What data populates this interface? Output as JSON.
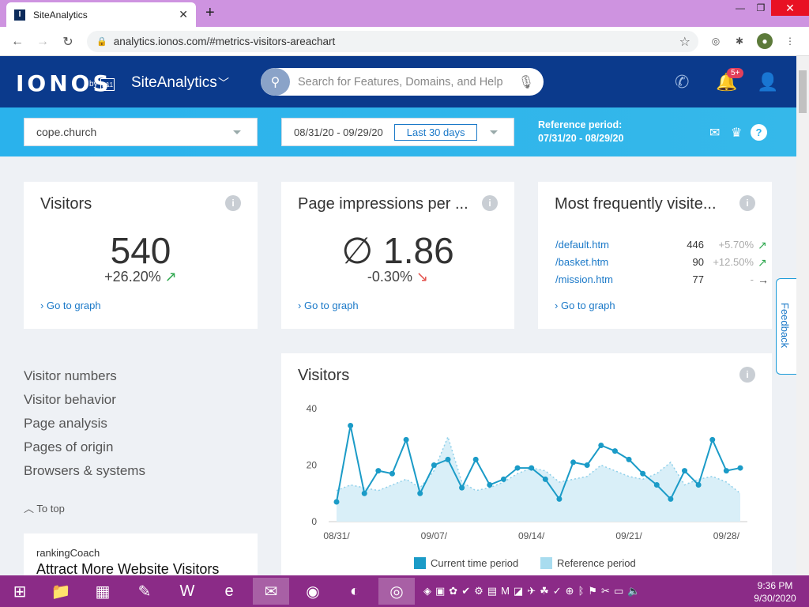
{
  "browser": {
    "tab_title": "SiteAnalytics",
    "tab_favicon": "I",
    "new_tab": "+",
    "url": "analytics.ionos.com/#metrics-visitors-areachart",
    "window_minimize": "—",
    "window_maximize": "❐",
    "window_close": "✕"
  },
  "header": {
    "logo": "IONOS",
    "logo_by": "by",
    "logo_box": "1&1",
    "app_name": "SiteAnalytics",
    "search_placeholder": "Search for Features, Domains, and Help",
    "notification_badge": "5+"
  },
  "filters": {
    "domain": "cope.church",
    "date_range": "08/31/20 - 09/29/20",
    "range_preset": "Last 30 days",
    "reference_label": "Reference period:",
    "reference_range": "07/31/20 - 08/29/20"
  },
  "cards": {
    "visitors": {
      "title": "Visitors",
      "value": "540",
      "change": "+26.20%",
      "trend": "up",
      "link": "Go to graph"
    },
    "impressions": {
      "title": "Page impressions per ...",
      "value": "∅ 1.86",
      "change": "-0.30%",
      "trend": "down",
      "link": "Go to graph"
    },
    "pages": {
      "title": "Most frequently visite...",
      "rows": [
        {
          "path": "/default.htm",
          "count": "446",
          "change": "+5.70%",
          "trend": "up"
        },
        {
          "path": "/basket.htm",
          "count": "90",
          "change": "+12.50%",
          "trend": "up"
        },
        {
          "path": "/mission.htm",
          "count": "77",
          "change": "-",
          "trend": "flat"
        }
      ],
      "link": "Go to graph"
    }
  },
  "sidenav": {
    "items": [
      "Visitor numbers",
      "Visitor behavior",
      "Page analysis",
      "Pages of origin",
      "Browsers & systems"
    ],
    "to_top": "To top"
  },
  "promo": {
    "brand": "rankingCoach",
    "headline": "Attract More Website Visitors"
  },
  "feedback": "Feedback",
  "chart_data": {
    "type": "area",
    "title": "Visitors",
    "ylim": [
      0,
      40
    ],
    "yticks": [
      0,
      20,
      40
    ],
    "x_tick_labels": [
      "08/31/",
      "09/07/",
      "09/14/",
      "09/21/",
      "09/28/"
    ],
    "series": [
      {
        "name": "Current time period",
        "color": "#1b9bc7",
        "values": [
          7,
          34,
          10,
          18,
          17,
          29,
          10,
          20,
          22,
          12,
          22,
          13,
          15,
          19,
          19,
          15,
          8,
          21,
          20,
          27,
          25,
          22,
          17,
          13,
          8,
          18,
          13,
          29,
          18,
          19
        ]
      },
      {
        "name": "Reference period",
        "color": "#a8dcef",
        "values": [
          11,
          13,
          12,
          11,
          13,
          15,
          12,
          18,
          30,
          14,
          11,
          12,
          14,
          17,
          19,
          18,
          14,
          15,
          16,
          20,
          18,
          16,
          15,
          17,
          21,
          13,
          15,
          16,
          14,
          10
        ]
      }
    ]
  },
  "taskbar": {
    "clock_time": "9:36 PM",
    "clock_date": "9/30/2020"
  }
}
